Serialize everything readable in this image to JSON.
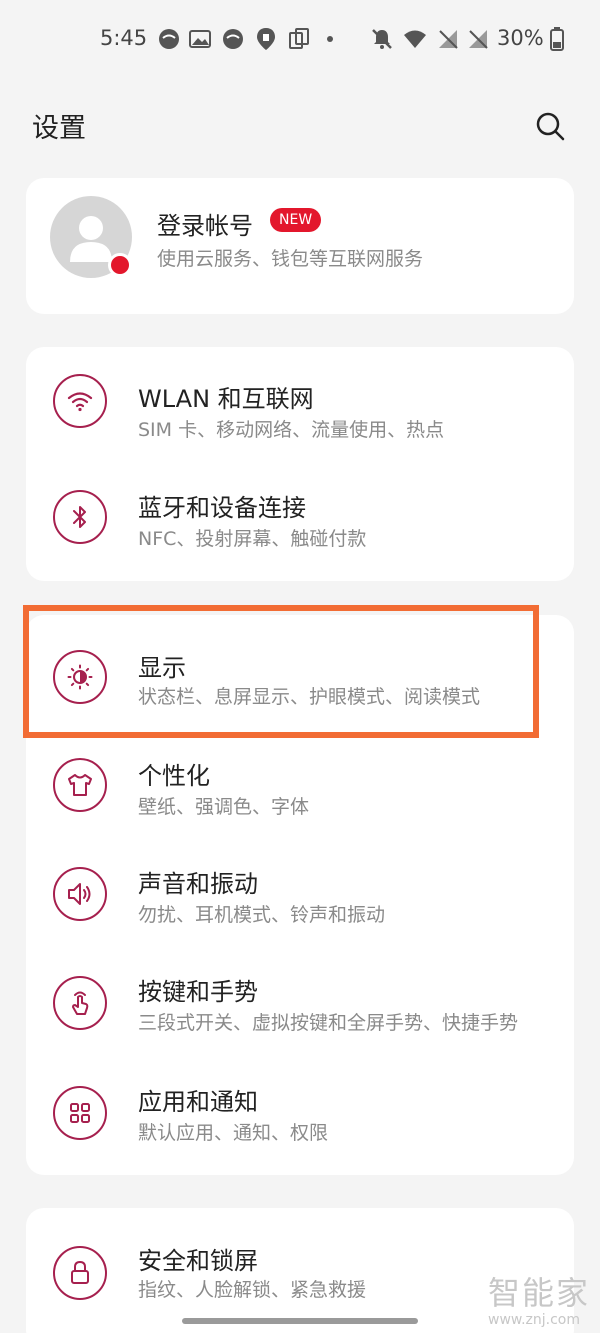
{
  "status_bar": {
    "time": "5:45",
    "battery": "30%",
    "icons": [
      "notification-circle-icon",
      "image-icon",
      "notification-circle-icon",
      "location-icon",
      "copy-icon",
      "dot-icon",
      "mute-bell-icon",
      "wifi-icon",
      "signal-off-icon",
      "signal-off-icon",
      "battery-icon"
    ]
  },
  "header": {
    "title": "设置",
    "search_icon": "search-icon"
  },
  "account": {
    "title": "登录帐号",
    "badge": "NEW",
    "subtitle": "使用云服务、钱包等互联网服务",
    "badge_color": "#e3172c"
  },
  "groups": [
    {
      "items": [
        {
          "title": "WLAN 和互联网",
          "subtitle": "SIM 卡、移动网络、流量使用、热点",
          "icon": "wifi-icon"
        },
        {
          "title": "蓝牙和设备连接",
          "subtitle": "NFC、投射屏幕、触碰付款",
          "icon": "bluetooth-icon"
        }
      ]
    },
    {
      "items": [
        {
          "title": "显示",
          "subtitle": "状态栏、息屏显示、护眼模式、阅读模式",
          "icon": "brightness-icon"
        },
        {
          "title": "个性化",
          "subtitle": "壁纸、强调色、字体",
          "icon": "tshirt-icon"
        },
        {
          "title": "声音和振动",
          "subtitle": "勿扰、耳机模式、铃声和振动",
          "icon": "speaker-icon"
        },
        {
          "title": "按键和手势",
          "subtitle": "三段式开关、虚拟按键和全屏手势、快捷手势",
          "icon": "gesture-icon"
        },
        {
          "title": "应用和通知",
          "subtitle": "默认应用、通知、权限",
          "icon": "apps-grid-icon"
        }
      ]
    },
    {
      "items": [
        {
          "title": "安全和锁屏",
          "subtitle": "指纹、人脸解锁、紧急救援",
          "icon": "lock-icon"
        }
      ]
    }
  ],
  "watermark": {
    "text": "智能家",
    "url": "www.znj.com"
  },
  "colors": {
    "accent": "#a6204e",
    "highlight": "#f26c34",
    "background": "#f4f4f4"
  }
}
